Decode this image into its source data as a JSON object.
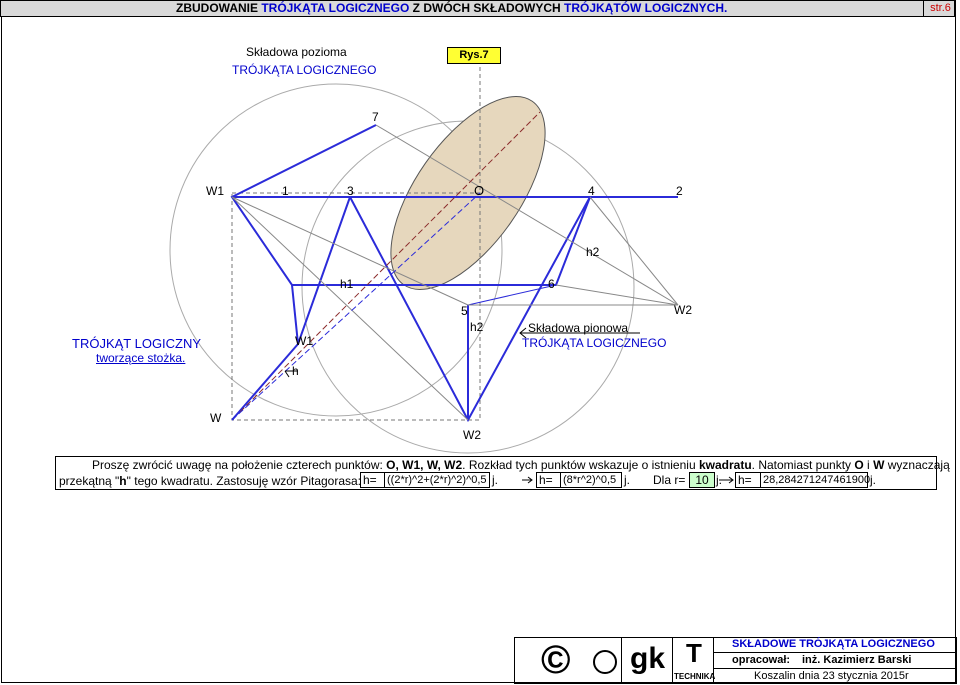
{
  "header": {
    "title_part1": "ZBUDOWANIE ",
    "title_part2": "TRÓJKĄTA LOGICZNEGO",
    "title_part3": " Z DWÓCH SKŁADOWYCH ",
    "title_part4": "TRÓJKĄTÓW LOGICZNYCH.",
    "page": "str.6"
  },
  "figure": {
    "rys": "Rys.7",
    "horizontal_label": "Składowa pozioma",
    "horizontal_sub": "TRÓJKĄTA LOGICZNEGO",
    "vertical_label": "Składowa pionowa",
    "vertical_sub": "TRÓJKĄTA LOGICZNEGO",
    "left_title": "TRÓJKĄT LOGICZNY",
    "left_sub": "tworzące stożka.",
    "points": {
      "p7": "7",
      "W1a": "W1",
      "p1": "1",
      "p3": "3",
      "O": "O",
      "p4": "4",
      "p2": "2",
      "h2a": "h2",
      "h1": "h1",
      "p6": "6",
      "p5": "5",
      "h2b": "h2",
      "W2a": "W2",
      "W1b": "W1",
      "h": "h",
      "W": "W",
      "W2b": "W2"
    }
  },
  "note": {
    "row1_a": "Proszę zwrócić uwagę na położenie czterech punktów: ",
    "row1_b": "O, W1, W, W2",
    "row1_c": ". Rozkład tych punktów wskazuje o istnieniu ",
    "row1_d": "kwadratu",
    "row1_e": ". Natomiast punkty ",
    "row1_f": "O",
    "row1_g": " i ",
    "row1_h": "W",
    "row1_i": " wyznaczają",
    "row2_a": "przekątną \"",
    "row2_b": "h",
    "row2_c": "\" tego kwadratu. Zastosuję wzór Pitagorasa:",
    "h1": "h=",
    "f1": "((2*r)^2+(2*r)^2)^0,5",
    "j1": "j.",
    "h2": "h=",
    "f2": "(8*r^2)^0,5",
    "j2": "j.",
    "dla": "Dla r=",
    "r": "10",
    "j3": "j.",
    "h3": "h=",
    "result": "28,284271247461900",
    "j4": "j."
  },
  "footer": {
    "copyright": "©",
    "gk": "gk",
    "T": "T",
    "technika": "TECHNIKA",
    "title": "SKŁADOWE TRÓJKĄTA LOGICZNEGO",
    "author_label": "opracował:",
    "author": "inż. Kazimierz Barski",
    "date": "Koszalin dnia 23 stycznia 2015r"
  },
  "colors": {
    "accent": "#0000cc",
    "highlight": "#ffff33",
    "green": "#ccffcc",
    "ellipse": "#e6d7bd"
  }
}
